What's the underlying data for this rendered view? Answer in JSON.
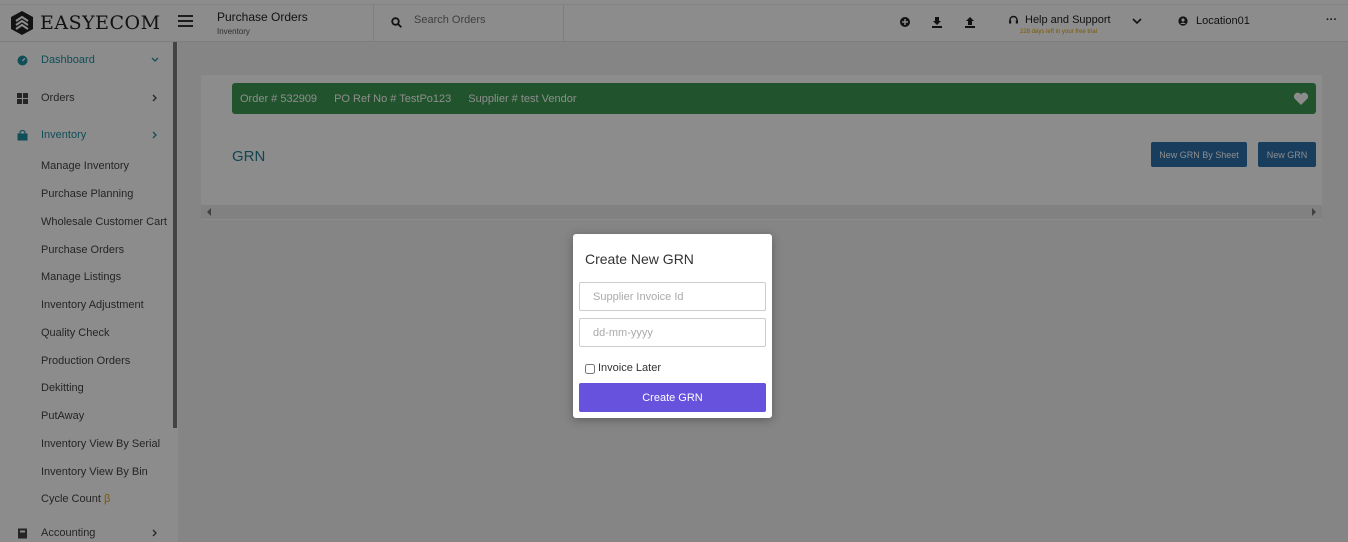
{
  "app": {
    "logo_text": "EASYECOM"
  },
  "header": {
    "title": "Purchase Orders",
    "subtitle": "Inventory",
    "search_placeholder": "Search Orders",
    "help_label": "Help and Support",
    "trial_text": "228 days left in your free trial",
    "location": "Location01",
    "more": "···"
  },
  "sidebar": {
    "items": [
      {
        "label": "Dashboard",
        "icon": "dashboard-icon",
        "active": true
      },
      {
        "label": "Orders",
        "icon": "grid-icon",
        "active": false
      },
      {
        "label": "Inventory",
        "icon": "bag-icon",
        "active": true
      },
      {
        "label": "Accounting",
        "icon": "accounting-icon",
        "active": false
      }
    ],
    "inventory_sub": [
      "Manage Inventory",
      "Purchase Planning",
      "Wholesale Customer Cart",
      "Purchase Orders",
      "Manage Listings",
      "Inventory Adjustment",
      "Quality Check",
      "Production Orders",
      "Dekitting",
      "PutAway",
      "Inventory View By Serial",
      "Inventory View By Bin",
      "Cycle Count"
    ],
    "beta_symbol": "β"
  },
  "order_banner": {
    "order": "Order # 532909",
    "po_ref": "PO Ref No # TestPo123",
    "supplier": "Supplier # test Vendor"
  },
  "grn": {
    "title": "GRN",
    "new_by_sheet": "New GRN By Sheet",
    "new_grn": "New GRN"
  },
  "modal": {
    "title": "Create New GRN",
    "invoice_placeholder": "Supplier Invoice Id",
    "date_placeholder": "dd-mm-yyyy",
    "invoice_later": "Invoice Later",
    "submit": "Create GRN"
  },
  "colors": {
    "accent_teal": "#1f8fa0",
    "banner_green": "#3d9a52",
    "button_blue": "#2c6fa9",
    "modal_button": "#6652dc",
    "trial_orange": "#e6a400"
  }
}
